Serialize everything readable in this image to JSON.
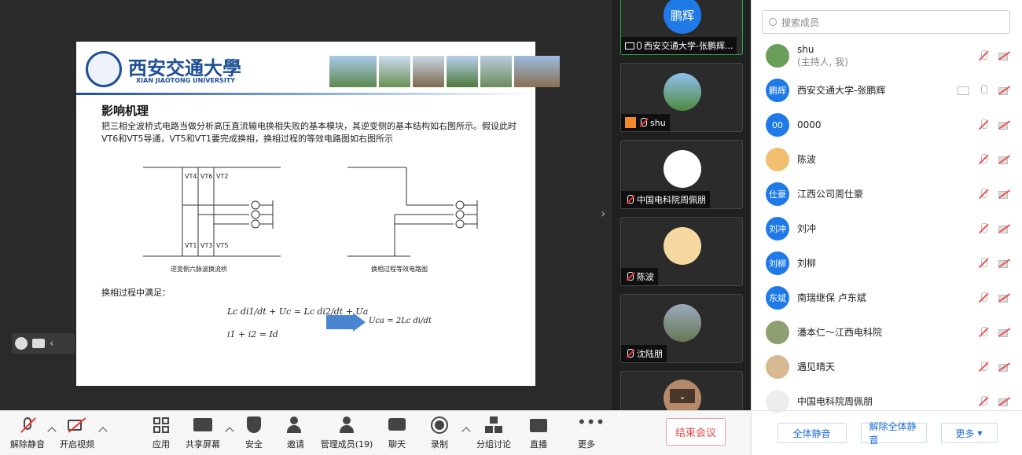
{
  "slide": {
    "logo_cn": "西安交通大學",
    "logo_en": "XIAN JIAOTONG UNIVERSITY",
    "title": "影响机理",
    "para": "把三相全波桥式电路当做分析高压直流输电换相失败的基本模块，其逆变侧的基本结构如右图所示。假设此时VT6和VT5导通，VT5和VT1要完成换相，换相过程的等效电路图如右图所示",
    "cap_left": "逆变侧六脉波换流桥",
    "cap_right": "换相过程等效电路图",
    "label_vt1": "VT1",
    "label_vt3": "VT3",
    "label_vt5": "VT5",
    "label_vt4": "VT4",
    "label_vt6": "VT6",
    "label_vt2": "VT2",
    "eq_intro": "换相过程中满足：",
    "eq1": "Lc di1/dt + Uc = Lc di2/dt + Ua",
    "eq2": "i1 + i2 = Id",
    "eq3": "Uca = 2Lc di/dt"
  },
  "gallery": {
    "tiles": [
      {
        "avatar": "鹏辉",
        "name": "西安交通大学-张鹏辉..."
      },
      {
        "name": "shu"
      },
      {
        "name": "中国电科院周佩朋"
      },
      {
        "name": "陈波"
      },
      {
        "name": "沈陆朋"
      }
    ]
  },
  "panel": {
    "search_placeholder": "搜索成员",
    "members": [
      {
        "avatar": "",
        "name": "shu",
        "sub": "(主持人, 我)",
        "color": "#6a9e5a"
      },
      {
        "avatar": "鹏辉",
        "name": "西安交通大学-张鹏辉",
        "sub": "",
        "color": "#1f7ae8"
      },
      {
        "avatar": "00",
        "name": "0000",
        "sub": "",
        "color": "#1f7ae8"
      },
      {
        "avatar": "",
        "name": "陈波",
        "sub": "",
        "color": "#f0c070"
      },
      {
        "avatar": "仕豪",
        "name": "江西公司周仕豪",
        "sub": "",
        "color": "#1f7ae8"
      },
      {
        "avatar": "刘冲",
        "name": "刘冲",
        "sub": "",
        "color": "#1f7ae8"
      },
      {
        "avatar": "刘柳",
        "name": "刘柳",
        "sub": "",
        "color": "#1f7ae8"
      },
      {
        "avatar": "东斌",
        "name": "南瑞继保 卢东斌",
        "sub": "",
        "color": "#1f7ae8"
      },
      {
        "avatar": "",
        "name": "潘本仁～江西电科院",
        "sub": "",
        "color": "#8fa070"
      },
      {
        "avatar": "",
        "name": "遇见晴天",
        "sub": "",
        "color": "#d8b890"
      },
      {
        "avatar": "",
        "name": "中国电科院周佩朋",
        "sub": "",
        "color": "#eee"
      }
    ],
    "mute_all": "全体静音",
    "unmute_all": "解除全体静音",
    "more": "更多"
  },
  "toolbar": {
    "unmute": "解除静音",
    "video": "开启视频",
    "apps": "应用",
    "share": "共享屏幕",
    "security": "安全",
    "invite": "邀请",
    "members": "管理成员(19)",
    "chat": "聊天",
    "record": "录制",
    "breakout": "分组讨论",
    "live": "直播",
    "more": "更多",
    "end": "结束会议"
  }
}
